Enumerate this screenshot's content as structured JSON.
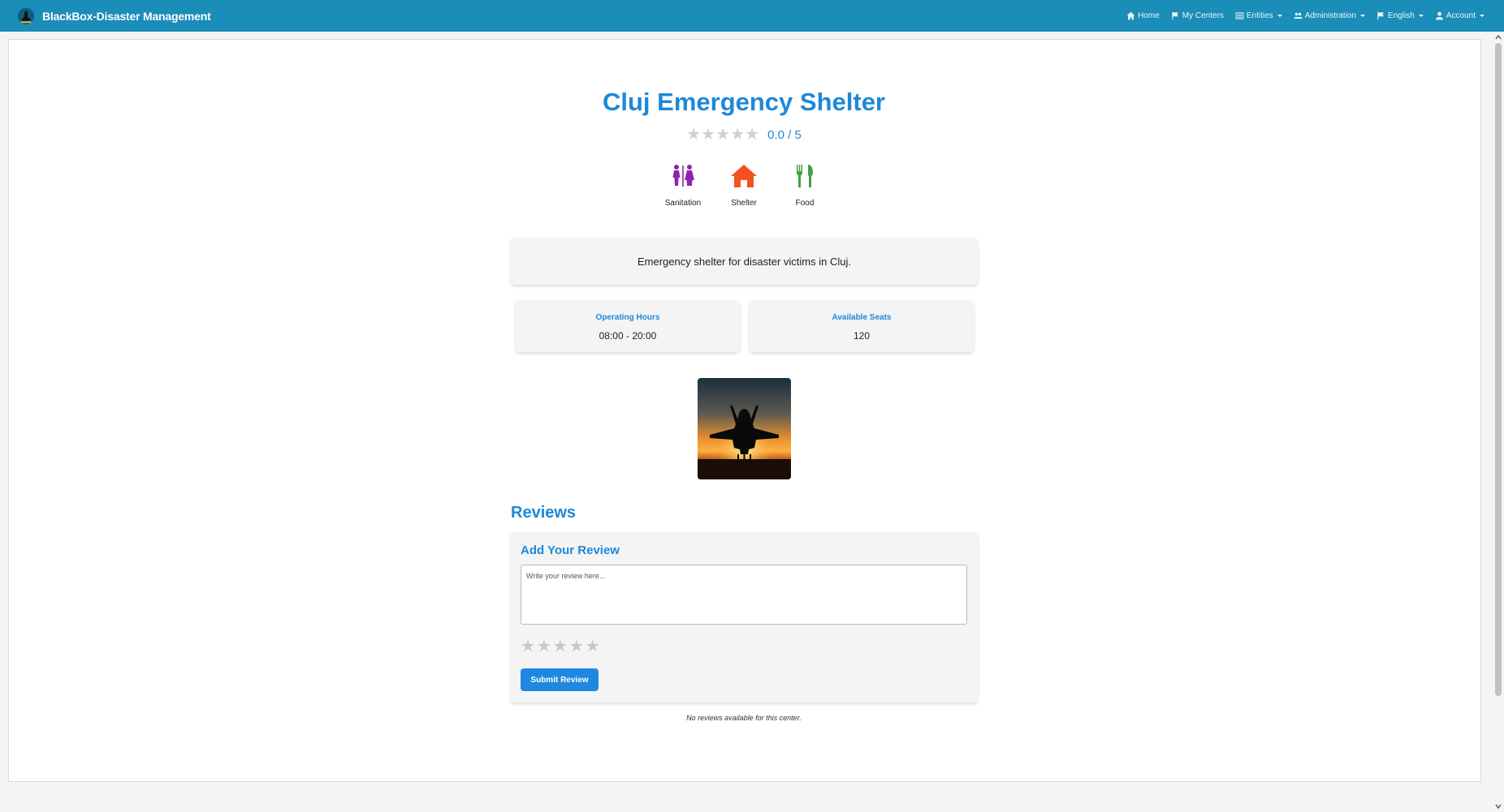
{
  "navbar": {
    "brand": "BlackBox-Disaster Management",
    "items": [
      {
        "label": "Home",
        "icon": "home-icon"
      },
      {
        "label": "My Centers",
        "icon": "flag-icon"
      },
      {
        "label": "Entities",
        "icon": "list-icon"
      },
      {
        "label": "Administration",
        "icon": "users-icon"
      },
      {
        "label": "English",
        "icon": "flag-icon"
      },
      {
        "label": "Account",
        "icon": "user-icon"
      }
    ]
  },
  "center": {
    "name": "Cluj Emergency Shelter",
    "rating_text": "0.0 / 5",
    "rating": 0,
    "description": "Emergency shelter for disaster victims in Cluj.",
    "facilities": [
      {
        "label": "Sanitation",
        "icon": "restroom-icon",
        "color": "#8e24aa"
      },
      {
        "label": "Shelter",
        "icon": "house-icon",
        "color": "#f4511e"
      },
      {
        "label": "Food",
        "icon": "utensils-icon",
        "color": "#43a047"
      }
    ],
    "operating_hours": {
      "label": "Operating Hours",
      "value": "08:00 - 20:00"
    },
    "available_seats": {
      "label": "Available Seats",
      "value": "120"
    }
  },
  "reviews": {
    "title": "Reviews",
    "form_title": "Add Your Review",
    "placeholder": "Write your review here...",
    "submit_label": "Submit Review",
    "empty_text": "No reviews available for this center."
  },
  "colors": {
    "navbar": "#1a8db8",
    "accent": "#1e88d8",
    "star_inactive": "#d0d0d0"
  }
}
